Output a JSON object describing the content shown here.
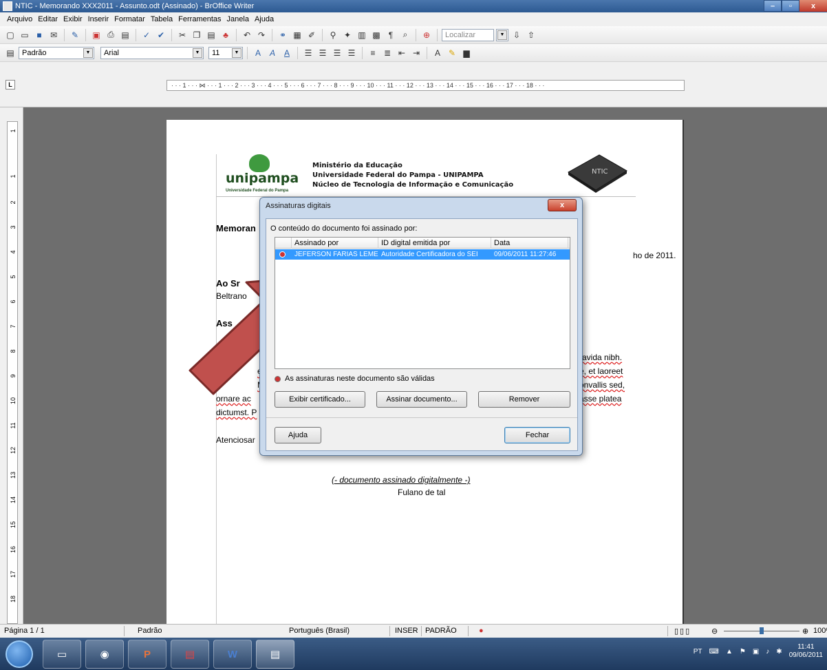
{
  "window": {
    "title": "NTIC - Memorando XXX2011 - Assunto.odt (Assinado) - BrOffice Writer",
    "min_label": "–",
    "max_label": "▫",
    "close_label": "x"
  },
  "menu": [
    "Arquivo",
    "Editar",
    "Exibir",
    "Inserir",
    "Formatar",
    "Tabela",
    "Ferramentas",
    "Janela",
    "Ajuda"
  ],
  "toolbar": {
    "find_placeholder": "Localizar",
    "style_value": "Padrão",
    "font_value": "Arial",
    "size_value": "11"
  },
  "ruler": {
    "corner": "L",
    "marks": "· · · 1 · · · ⋈ · · · 1 · · · 2 · · · 3 · · · 4 · · · 5 · · · 6 · · · 7 · · · 8 · · · 9 · · · 10 · · · 11 · · · 12 · · · 13 · · · 14 · · · 15 · · · 16 · · · 17 · · · 18 · · ·",
    "vertical": [
      "1",
      "1",
      "2",
      "3",
      "4",
      "5",
      "6",
      "7",
      "8",
      "9",
      "10",
      "11",
      "12",
      "13",
      "14",
      "15",
      "16",
      "17",
      "18"
    ]
  },
  "document": {
    "logo_text": "unipampa",
    "logo_sub": "Universidade Federal do Pampa",
    "header_lines": [
      "Ministério da Educação",
      "Universidade Federal do Pampa - UNIPAMPA",
      "Núcleo de Tecnologia de Informação e Comunicação"
    ],
    "chip_label": "NTIC",
    "memo_title": "Memoran",
    "date_fragment": "ho de 2011.",
    "ao_label": "Ao Sr",
    "recipient": "Beltrano",
    "assunto_fragment": "Ass",
    "body_right": [
      "ravida nibh.",
      "e, et laoreet",
      "onvallis sed,",
      "asse platea"
    ],
    "body_left": [
      "el",
      "Ma",
      "ornare  ac",
      "dictumst. P"
    ],
    "closing": "Atenciosar",
    "signature_note": "(- documento assinado digitalmente -)",
    "signer": "Fulano de tal"
  },
  "dialog": {
    "title": "Assinaturas digitais",
    "close_label": "x",
    "prompt": "O conteúdo do documento foi assinado por:",
    "columns": [
      "Assinado por",
      "ID digital emitida por",
      "Data"
    ],
    "rows": [
      {
        "signer": "JEFERSON FARIAS LEME",
        "issuer": "Autoridade Certificadora do SEI",
        "date": "09/06/2011 11:27:46"
      }
    ],
    "status": "As assinaturas neste documento são válidas",
    "buttons": {
      "view_cert": "Exibir certificado...",
      "sign": "Assinar documento...",
      "remove": "Remover",
      "help": "Ajuda",
      "close": "Fechar"
    }
  },
  "status_bar": {
    "page": "Página 1 / 1",
    "style": "Padrão",
    "language": "Português (Brasil)",
    "insert": "INSER",
    "mode": "PADRÃO",
    "zoom": "100%"
  },
  "taskbar": {
    "apps": [
      "explorer",
      "firefox",
      "powerpoint",
      "pdf",
      "word",
      "writer"
    ],
    "tray_lang": "PT",
    "time": "11:41",
    "date": "09/06/2011"
  },
  "colors": {
    "arrow_fill": "#c0504d",
    "arrow_stroke": "#7a2a28",
    "selection": "#3399ff"
  }
}
